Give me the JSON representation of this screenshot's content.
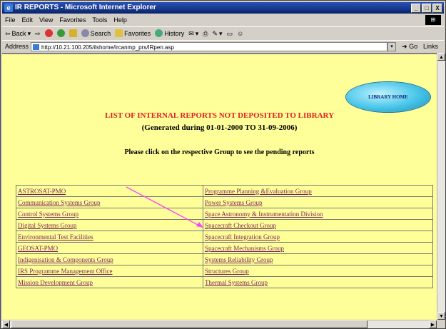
{
  "window": {
    "title": "IR REPORTS - Microsoft Internet Explorer",
    "controls": [
      "_",
      "□",
      "X"
    ]
  },
  "menu": [
    "File",
    "Edit",
    "View",
    "Favorites",
    "Tools",
    "Help"
  ],
  "toolbar": {
    "back": "Back",
    "search": "Search",
    "favorites": "Favorites",
    "history": "History"
  },
  "address": {
    "label": "Address",
    "url": "http://10.21.100.205/ilshome/ircanmp_prs/IRpen.asp",
    "go": "Go",
    "links": "Links"
  },
  "page": {
    "library_home": "LIBRARY HOME",
    "heading": "LIST OF INTERNAL REPORTS NOT DEPOSITED TO LIBRARY",
    "subheading": "(Generated during 01-01-2000 TO 31-09-2006)",
    "instruction": "Please click on the respective Group to see the pending reports"
  },
  "groups": {
    "left": [
      "ASTROSAT-PMO",
      "Communication Systems Group",
      "Control Systems Group",
      "Digital Systems Group",
      "Environmental Test Facilities",
      "GEOSAT-PMO",
      "Indigenisation & Components Group",
      "IRS Programme Management Office",
      "Mission Development Group"
    ],
    "right": [
      "Programme Planning &Evaluation Group",
      "Power Systems Group",
      "Space Astronomy & Instrumentation Division",
      "Spacecraft Checkout Group",
      "Spacecraft Integration Group",
      "Spacecraft Mechanisms Group",
      "Systems Reliability Group",
      "Structures Group",
      "Thermal Systems Group"
    ]
  },
  "colors": {
    "page_bg": "#ffff99",
    "link": "#7a1f5c",
    "heading": "#e02020",
    "annotation_arrow": "#ff44ff"
  }
}
